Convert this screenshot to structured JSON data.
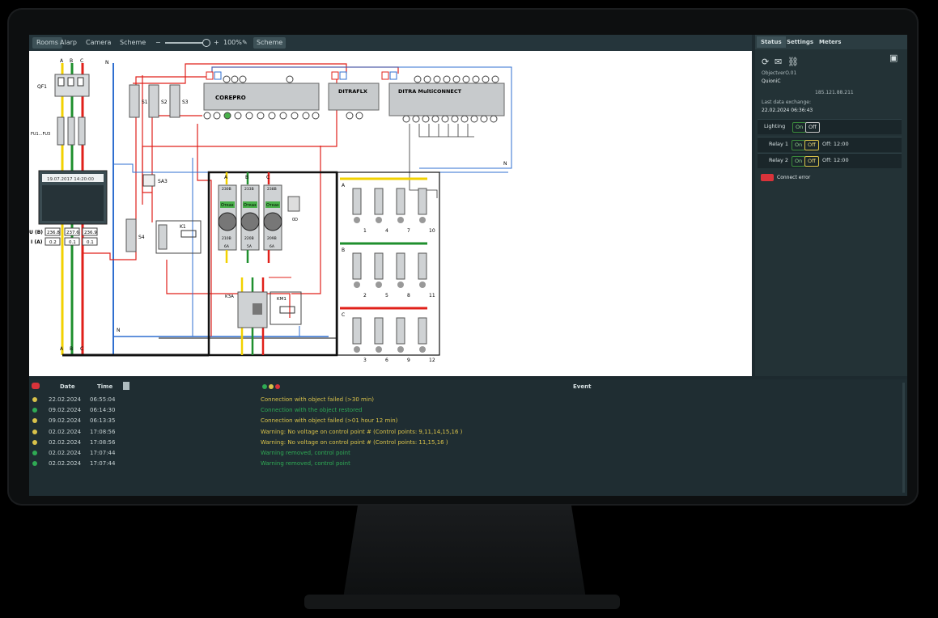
{
  "toolbar": {
    "tabs": [
      "Rooms",
      "Alarp",
      "Camera",
      "Scheme"
    ],
    "zoom_minus": "−",
    "zoom_plus": "+",
    "zoom_level": "100%",
    "scheme_button": "Scheme"
  },
  "scheme": {
    "phases": [
      "A",
      "B",
      "C",
      "N"
    ],
    "qf1": "QF1",
    "fu": "FU1...FU3",
    "meter_datetime": "19.07.2017 14:20:00",
    "ub_label": "U (B)",
    "ia_label": "I (A)",
    "voltages": [
      "236.8",
      "237.6",
      "236.9"
    ],
    "currents": [
      "0.2",
      "0.1",
      "0.1"
    ],
    "switches": [
      "S1",
      "S2",
      "S3",
      "S4"
    ],
    "sa3": "SA3",
    "k1": "K1",
    "k3a": "K3A",
    "km1": "KM1",
    "module_corepro": "COREPRO",
    "module_ditraflx": "DITRAFLX",
    "module_multiconnect": "DITRA MultiCONNECT",
    "module_volts_top": [
      "230B",
      "233B",
      "238B"
    ],
    "module_status": [
      "Отказ",
      "Отказ",
      "Отказ"
    ],
    "module_volts_bot": [
      "210B",
      "220B",
      "209B"
    ],
    "module_currents": [
      "6A",
      "5A",
      "6A"
    ],
    "od": "0D",
    "breaker_groups": [
      {
        "phase": "A",
        "nums": [
          "1",
          "4",
          "7",
          "10"
        ]
      },
      {
        "phase": "B",
        "nums": [
          "2",
          "5",
          "8",
          "11"
        ]
      },
      {
        "phase": "C",
        "nums": [
          "3",
          "6",
          "9",
          "12"
        ]
      }
    ],
    "n_label": "N"
  },
  "panel": {
    "tabs": [
      "Status",
      "Settings",
      "Meters"
    ],
    "object_line": "ObjectverO.01",
    "object_name": "QuioniC",
    "ip": "185.121.88.211",
    "last_exchange_label": "Last data exchange:",
    "last_exchange_value": "22.02.2024 06:36:43",
    "lighting": "Lighting",
    "on": "On",
    "off": "Off",
    "relay1": "Relay 1",
    "relay2": "Relay 2",
    "relay1_time": "Off: 12:00",
    "relay2_time": "Off: 12:00",
    "error": "Connect error"
  },
  "log": {
    "headers": {
      "date": "Date",
      "time": "Time",
      "event": "Event"
    },
    "rows": [
      {
        "date": "22.02.2024",
        "time": "06:55:04",
        "event": "Connection with object failed (>30 min)",
        "color": "#d9c24a",
        "text": "#d9c24a"
      },
      {
        "date": "09.02.2024",
        "time": "06:14:30",
        "event": "Connection with the object restored",
        "color": "#2faa54",
        "text": "#2faa54"
      },
      {
        "date": "09.02.2024",
        "time": "06:13:35",
        "event": "Connection with object failed (>01 hour 12 min)",
        "color": "#d9c24a",
        "text": "#d9c24a"
      },
      {
        "date": "02.02.2024",
        "time": "17:08:56",
        "event": "Warning: No voltage on control point # (Control points: 9,11,14,15,16 )",
        "color": "#d9c24a",
        "text": "#d9c24a"
      },
      {
        "date": "02.02.2024",
        "time": "17:08:56",
        "event": "Warning: No voltage on control point # (Control points: 11,15,16 )",
        "color": "#d9c24a",
        "text": "#d9c24a"
      },
      {
        "date": "02.02.2024",
        "time": "17:07:44",
        "event": "Warning removed, control point",
        "color": "#2faa54",
        "text": "#2faa54"
      },
      {
        "date": "02.02.2024",
        "time": "17:07:44",
        "event": "Warning removed, control point",
        "color": "#2faa54",
        "text": "#2faa54"
      }
    ]
  },
  "colors": {
    "phaseA": "#f2d100",
    "phaseB": "#1f8f2e",
    "phaseC": "#e0201a",
    "neutral": "#2f6fd0",
    "ctrl": "#e0201a"
  }
}
